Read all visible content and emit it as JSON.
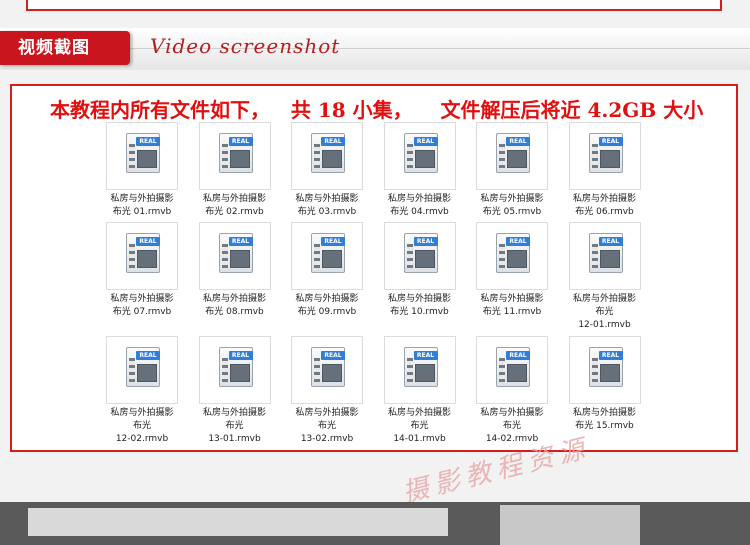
{
  "header": {
    "title": "视频截图",
    "subtitle": "Video screenshot"
  },
  "notice": {
    "text": "本教程内所有文件如下，   共 18 小集，    文件解压后将近 4.2GB 大小"
  },
  "file_icon": {
    "badge": "REAL",
    "icon": "realplayer-file-icon"
  },
  "files": [
    {
      "line1": "私房与外拍摄影",
      "line2": "布光 01.rmvb",
      "line3": ""
    },
    {
      "line1": "私房与外拍摄影",
      "line2": "布光 02.rmvb",
      "line3": ""
    },
    {
      "line1": "私房与外拍摄影",
      "line2": "布光 03.rmvb",
      "line3": ""
    },
    {
      "line1": "私房与外拍摄影",
      "line2": "布光 04.rmvb",
      "line3": ""
    },
    {
      "line1": "私房与外拍摄影",
      "line2": "布光 05.rmvb",
      "line3": ""
    },
    {
      "line1": "私房与外拍摄影",
      "line2": "布光 06.rmvb",
      "line3": ""
    },
    {
      "line1": "私房与外拍摄影",
      "line2": "布光 07.rmvb",
      "line3": ""
    },
    {
      "line1": "私房与外拍摄影",
      "line2": "布光 08.rmvb",
      "line3": ""
    },
    {
      "line1": "私房与外拍摄影",
      "line2": "布光 09.rmvb",
      "line3": ""
    },
    {
      "line1": "私房与外拍摄影",
      "line2": "布光 10.rmvb",
      "line3": ""
    },
    {
      "line1": "私房与外拍摄影",
      "line2": "布光 11.rmvb",
      "line3": ""
    },
    {
      "line1": "私房与外拍摄影",
      "line2": "布光",
      "line3": "12-01.rmvb"
    },
    {
      "line1": "私房与外拍摄影",
      "line2": "布光",
      "line3": "12-02.rmvb"
    },
    {
      "line1": "私房与外拍摄影",
      "line2": "布光",
      "line3": "13-01.rmvb"
    },
    {
      "line1": "私房与外拍摄影",
      "line2": "布光",
      "line3": "13-02.rmvb"
    },
    {
      "line1": "私房与外拍摄影",
      "line2": "布光",
      "line3": "14-01.rmvb"
    },
    {
      "line1": "私房与外拍摄影",
      "line2": "布光",
      "line3": "14-02.rmvb"
    },
    {
      "line1": "私房与外拍摄影",
      "line2": "布光 15.rmvb",
      "line3": ""
    }
  ],
  "watermark": "摄影教程资源"
}
